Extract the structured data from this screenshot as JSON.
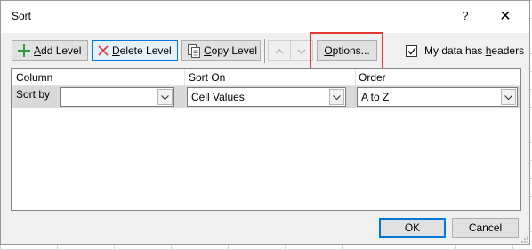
{
  "dialog": {
    "title": "Sort",
    "help_label": "?",
    "close_label": "✕"
  },
  "toolbar": {
    "add_level": {
      "pre": "",
      "key": "A",
      "post": "dd Level"
    },
    "delete_level": {
      "pre": "",
      "key": "D",
      "post": "elete Level"
    },
    "copy_level": {
      "pre": "",
      "key": "C",
      "post": "opy Level"
    },
    "options": {
      "pre": "",
      "key": "O",
      "post": "ptions..."
    },
    "headers_check": {
      "pre": "My data has ",
      "key": "h",
      "post": "eaders",
      "checked": true
    }
  },
  "grid": {
    "columns": [
      "Column",
      "Sort On",
      "Order"
    ],
    "row": {
      "label": "Sort by",
      "column_value": "",
      "sort_on_value": "Cell Values",
      "order_value": "A to Z"
    }
  },
  "footer": {
    "ok_label": "OK",
    "cancel_label": "Cancel"
  },
  "colors": {
    "highlight": "#e53935",
    "add_icon": "#2e9e3a",
    "delete_icon": "#e23a3a",
    "focus_border": "#0078d7"
  }
}
